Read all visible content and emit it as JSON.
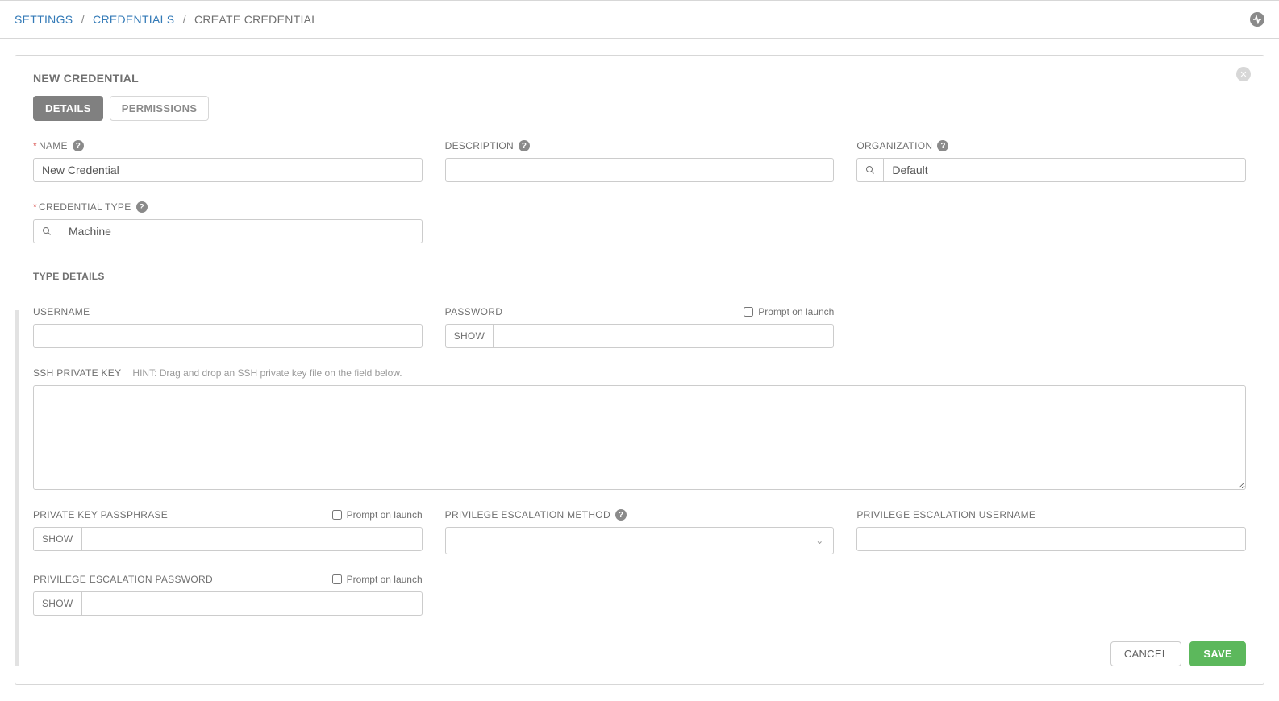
{
  "breadcrumb": {
    "settings": "SETTINGS",
    "credentials": "CREDENTIALS",
    "create": "CREATE CREDENTIAL"
  },
  "panel_title": "NEW CREDENTIAL",
  "tabs": {
    "details": "DETAILS",
    "permissions": "PERMISSIONS"
  },
  "labels": {
    "name": "NAME",
    "description": "DESCRIPTION",
    "organization": "ORGANIZATION",
    "credential_type": "CREDENTIAL TYPE",
    "type_details": "TYPE DETAILS",
    "username": "USERNAME",
    "password": "PASSWORD",
    "ssh_private_key": "SSH PRIVATE KEY",
    "ssh_hint": "HINT: Drag and drop an SSH private key file on the field below.",
    "private_key_passphrase": "PRIVATE KEY PASSPHRASE",
    "priv_esc_method": "PRIVILEGE ESCALATION METHOD",
    "priv_esc_username": "PRIVILEGE ESCALATION USERNAME",
    "priv_esc_password": "PRIVILEGE ESCALATION PASSWORD",
    "prompt_on_launch": "Prompt on launch",
    "show": "SHOW"
  },
  "values": {
    "name": "New Credential",
    "description": "",
    "organization": "Default",
    "credential_type": "Machine",
    "username": "",
    "password": "",
    "ssh_private_key": "",
    "private_key_passphrase": "",
    "priv_esc_method": "",
    "priv_esc_username": "",
    "priv_esc_password": ""
  },
  "buttons": {
    "cancel": "CANCEL",
    "save": "SAVE"
  }
}
